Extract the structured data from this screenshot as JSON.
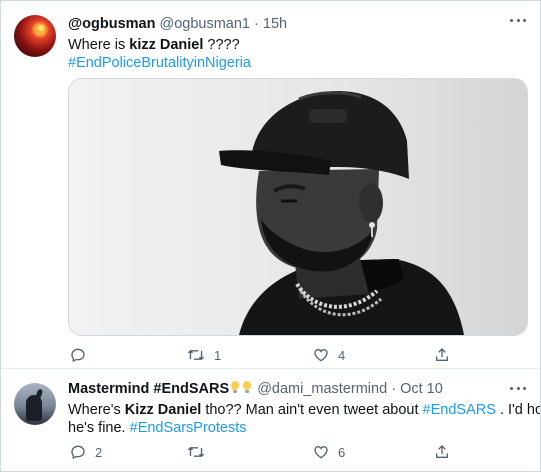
{
  "tweets": [
    {
      "display_name": "@ogbusman",
      "handle": "@ogbusman1",
      "separator": "·",
      "time": "15h",
      "text_1": "Where is ",
      "text_bold": "kizz Daniel",
      "text_2": " ????",
      "hashtag": "#EndPoliceBrutalityinNigeria",
      "actions": {
        "reply_count": "",
        "retweet_count": "1",
        "like_count": "4"
      }
    },
    {
      "display_name": "Mastermind #EndSARS",
      "handle": "@dami_mastermind",
      "separator": "·",
      "time": "Oct 10",
      "text_1": "Where's ",
      "text_bold": "Kizz Daniel",
      "text_2": " tho?? Man ain't even tweet about ",
      "hashtag_1": "#EndSARS",
      "text_3": " . I'd hope",
      "text_4": "he's fine. ",
      "hashtag_2": "#EndSarsProtests",
      "actions": {
        "reply_count": "2",
        "retweet_count": "",
        "like_count": "6"
      }
    }
  ],
  "icons": [
    "more-icon",
    "reply-icon",
    "retweet-icon",
    "like-icon",
    "share-icon",
    "light-bulb-emoji"
  ],
  "colors": {
    "link": "#1d9bf0",
    "secondary_text": "#536471",
    "border": "#cfd9de"
  }
}
